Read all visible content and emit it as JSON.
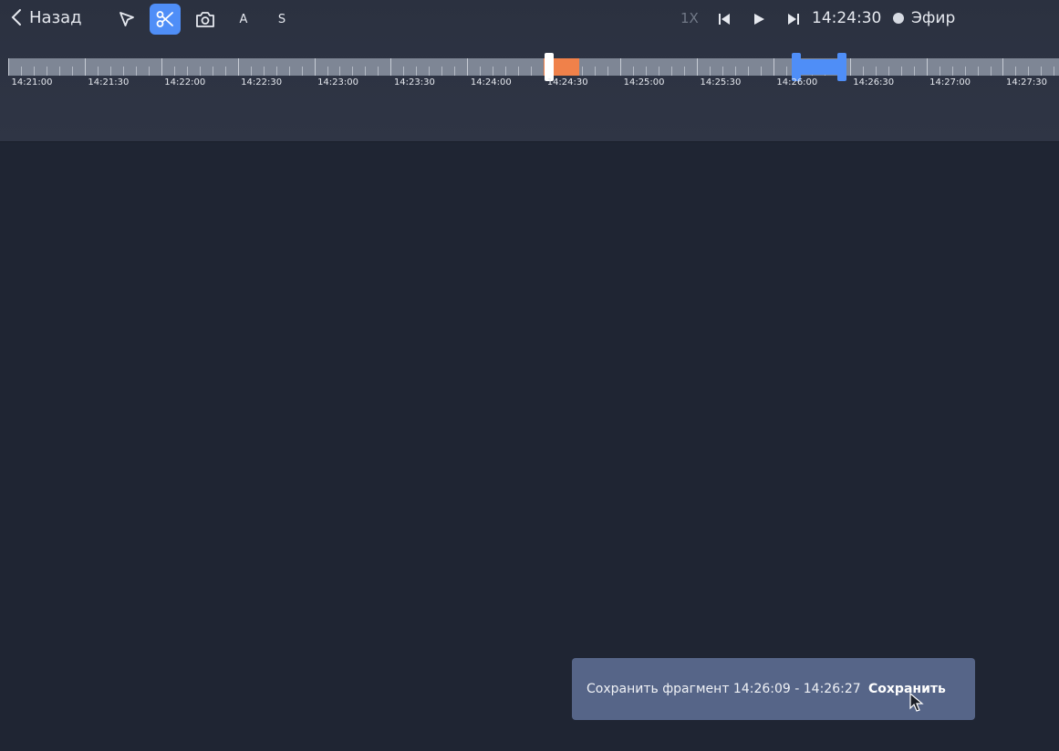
{
  "header": {
    "back_label": "Назад",
    "tools": {
      "pointer_icon": "cursor-arrow-icon",
      "cut_icon": "scissors-icon",
      "snapshot_icon": "camera-icon",
      "a_label": "A",
      "s_label": "S"
    },
    "rate": "1X",
    "current_time": "14:24:30",
    "live_label": "Эфир",
    "accent_color": "#4f8ef7"
  },
  "timeline": {
    "labels": [
      "14:21:00",
      "14:21:30",
      "14:22:00",
      "14:22:30",
      "14:23:00",
      "14:23:30",
      "14:24:00",
      "14:24:30",
      "14:25:00",
      "14:25:30",
      "14:26:00",
      "14:26:30",
      "14:27:00",
      "14:27:30"
    ],
    "start": "14:21:00",
    "end": "14:27:52",
    "playhead": "14:24:32",
    "recorded_segment": [
      "14:24:30",
      "14:24:44"
    ],
    "selection": [
      "14:26:09",
      "14:26:27"
    ],
    "recorded_color": "#f0814a",
    "selection_color": "#4f8ef7"
  },
  "toast": {
    "message": "Сохранить фрагмент 14:26:09 - 14:26:27",
    "save_label": "Сохранить"
  }
}
